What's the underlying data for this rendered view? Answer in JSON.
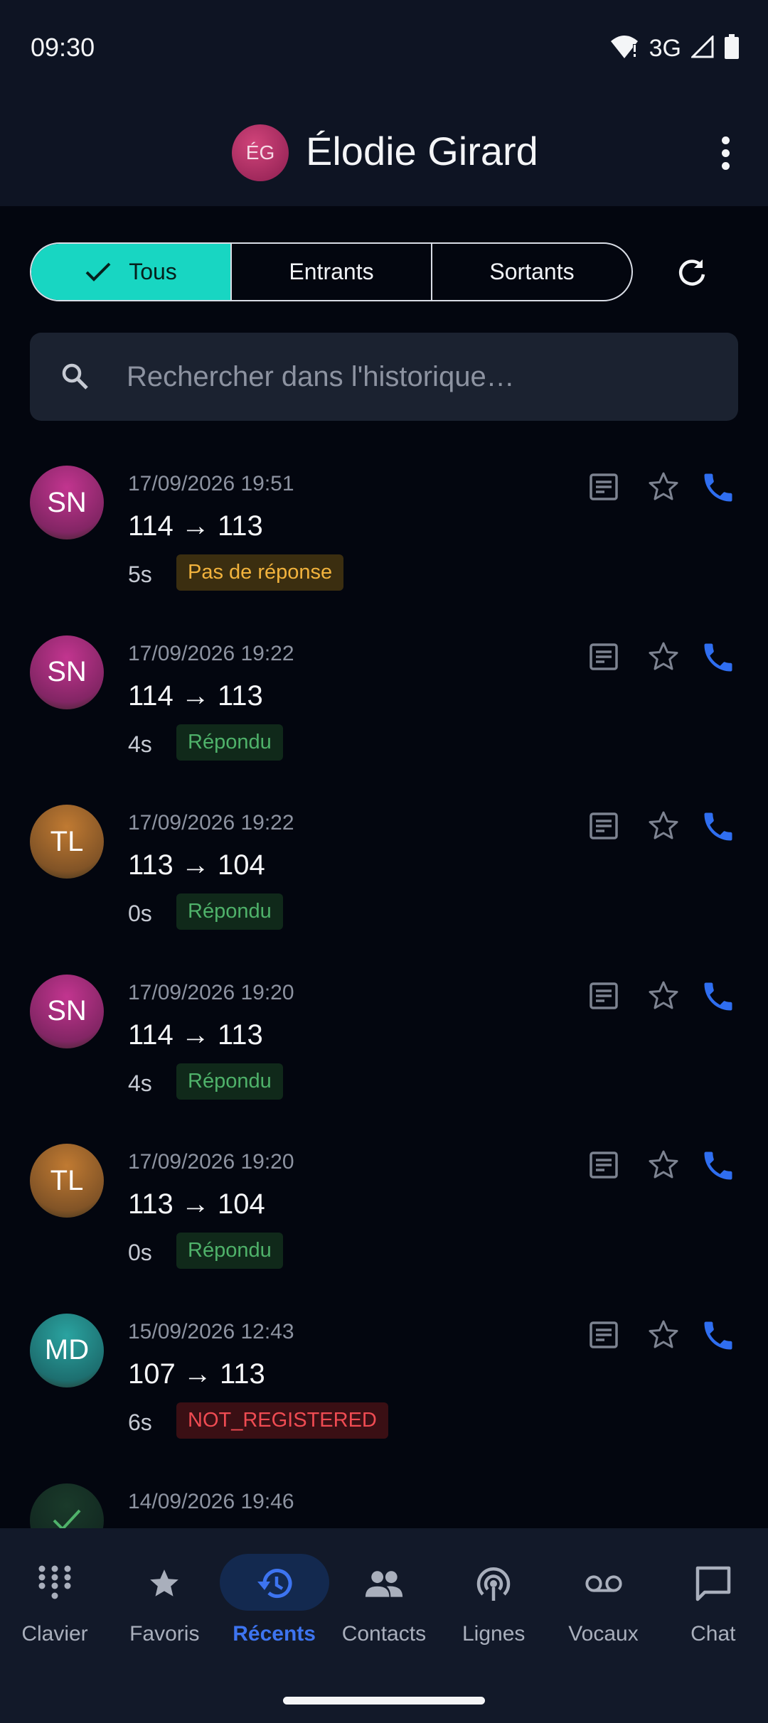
{
  "status_bar": {
    "time": "09:30",
    "network": "3G",
    "icons": [
      "wifi-alert-icon",
      "signal-icon",
      "battery-icon"
    ]
  },
  "app_bar": {
    "avatar_initials": "ÉG",
    "title": "Élodie Girard",
    "menu_icon": "more-vert-icon"
  },
  "filters": {
    "options": [
      "Tous",
      "Entrants",
      "Sortants"
    ],
    "selected": "Tous",
    "refresh_icon": "refresh-icon"
  },
  "search": {
    "placeholder": "Rechercher dans l'historique…",
    "value": ""
  },
  "calls": [
    {
      "initials": "SN",
      "datetime": "17/09/2026 19:51",
      "route": "114 → 113",
      "duration": "5s",
      "status": "Pas de réponse",
      "status_kind": "noanswer",
      "avatar_color": "#c2358f"
    },
    {
      "initials": "SN",
      "datetime": "17/09/2026 19:22",
      "route": "114 → 113",
      "duration": "4s",
      "status": "Répondu",
      "status_kind": "answered",
      "avatar_color": "#c2358f"
    },
    {
      "initials": "TL",
      "datetime": "17/09/2026 19:22",
      "route": "113 → 104",
      "duration": "0s",
      "status": "Répondu",
      "status_kind": "answered",
      "avatar_color": "#c07a32"
    },
    {
      "initials": "SN",
      "datetime": "17/09/2026 19:20",
      "route": "114 → 113",
      "duration": "4s",
      "status": "Répondu",
      "status_kind": "answered",
      "avatar_color": "#c2358f"
    },
    {
      "initials": "TL",
      "datetime": "17/09/2026 19:20",
      "route": "113 → 104",
      "duration": "0s",
      "status": "Répondu",
      "status_kind": "answered",
      "avatar_color": "#c07a32"
    },
    {
      "initials": "MD",
      "datetime": "15/09/2026 12:43",
      "route": "107 → 113",
      "duration": "6s",
      "status": "NOT_REGISTERED",
      "status_kind": "error",
      "avatar_color": "#2aa3a0"
    },
    {
      "initials": "",
      "avatar_icon": "check-icon",
      "datetime": "14/09/2026 19:46",
      "route": "",
      "duration": "",
      "status": "",
      "status_kind": "",
      "avatar_color": "#1a3a2a"
    }
  ],
  "row_actions": {
    "note_icon": "note-icon",
    "favorite_icon": "star-outline-icon",
    "call_icon": "phone-icon"
  },
  "colors": {
    "accent": "#18d6c2",
    "call": "#2f6ef0",
    "active_nav": "#3d74f0"
  },
  "bottom_nav": {
    "active": "Récents",
    "items": [
      {
        "label": "Clavier",
        "icon": "dialpad-icon"
      },
      {
        "label": "Favoris",
        "icon": "star-icon"
      },
      {
        "label": "Récents",
        "icon": "history-icon"
      },
      {
        "label": "Contacts",
        "icon": "people-icon"
      },
      {
        "label": "Lignes",
        "icon": "broadcast-icon"
      },
      {
        "label": "Vocaux",
        "icon": "voicemail-icon"
      },
      {
        "label": "Chat",
        "icon": "chat-icon"
      }
    ]
  }
}
